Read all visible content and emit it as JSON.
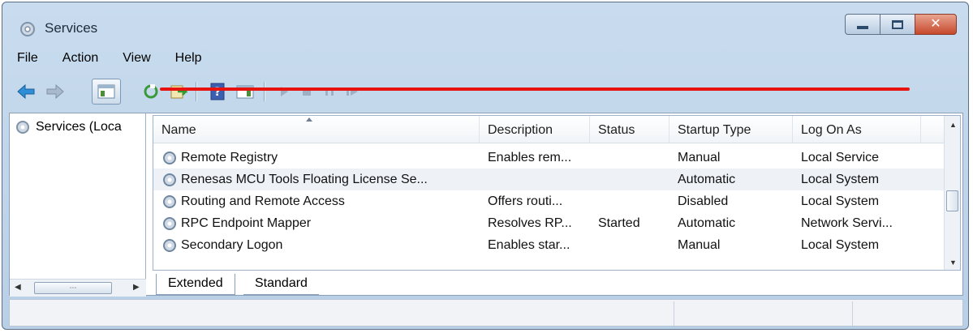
{
  "window": {
    "title": "Services",
    "icon": "services-gear-icon",
    "controls": [
      "minimize-icon",
      "maximize-icon",
      "close-icon"
    ]
  },
  "menu": {
    "file": "File",
    "action": "Action",
    "view": "View",
    "help": "Help"
  },
  "toolbar": {
    "icons": [
      "back-arrow-icon",
      "forward-arrow-icon",
      "console-tree-icon",
      "refresh-icon",
      "export-list-icon",
      "help-icon",
      "show-hide-pane-icon",
      "start-service-icon",
      "stop-service-icon",
      "pause-service-icon",
      "restart-service-icon"
    ]
  },
  "tree": {
    "item_label": "Services (Loca"
  },
  "columns": {
    "name": "Name",
    "description": "Description",
    "status": "Status",
    "startup_type": "Startup Type",
    "log_on_as": "Log On As"
  },
  "services": [
    {
      "name": "Remote Registry",
      "description": "Enables rem...",
      "status": "",
      "startup": "Manual",
      "logon": "Local Service"
    },
    {
      "name": "Renesas MCU Tools Floating License Se...",
      "description": "",
      "status": "",
      "startup": "Automatic",
      "logon": "Local System"
    },
    {
      "name": "Routing and Remote Access",
      "description": "Offers routi...",
      "status": "",
      "startup": "Disabled",
      "logon": "Local System"
    },
    {
      "name": "RPC Endpoint Mapper",
      "description": "Resolves RP...",
      "status": "Started",
      "startup": "Automatic",
      "logon": "Network Servi..."
    },
    {
      "name": "Secondary Logon",
      "description": "Enables star...",
      "status": "",
      "startup": "Manual",
      "logon": "Local System"
    }
  ],
  "tabs": {
    "extended": "Extended",
    "standard": "Standard"
  },
  "highlight": {
    "underline_color": "#e8130f",
    "highlighted_service": "Renesas MCU Tools Floating License Se..."
  },
  "colors": {
    "title_bar": "#c9dcef",
    "close_button": "#c6492c"
  }
}
